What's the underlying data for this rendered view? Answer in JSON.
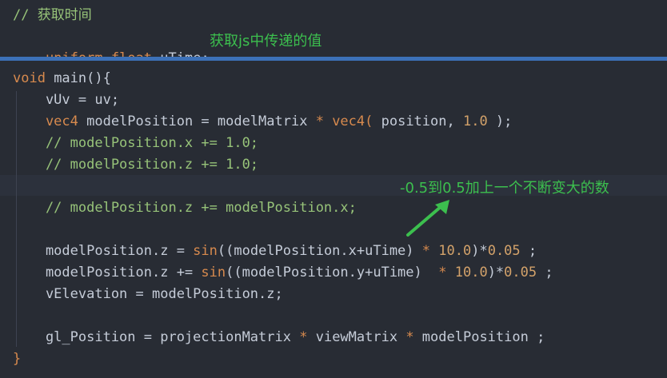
{
  "header": {
    "comment": "// 获取时间",
    "uniform_kw": "uniform",
    "float_kw": "float",
    "uniform_rest": " uTime;",
    "annotation": "获取js中传递的值"
  },
  "code": {
    "l1_kw": "void",
    "l1_rest": " main(){",
    "l2": "    vUv = uv;",
    "l3_kw": "    vec4",
    "l3_a": " modelPosition = modelMatrix ",
    "l3_op": "*",
    "l3_kw2": " vec4(",
    "l3_b": " position, ",
    "l3_num": "1.0",
    "l3_end": " );",
    "l4": "    // modelPosition.x += 1.0;",
    "l5": "    // modelPosition.z += 1.0;",
    "l7": "    // modelPosition.z += modelPosition.x;",
    "l9_a": "    modelPosition.z = ",
    "l9_sin": "sin",
    "l9_b": "((modelPosition.x+uTime) ",
    "l9_op": "*",
    "l9_sp": " ",
    "l9_num": "10.0",
    "l9_c": ")*",
    "l9_num2": "0.05",
    "l9_end": " ;",
    "l10_a": "    modelPosition.z += ",
    "l10_sin": "sin",
    "l10_b": "((modelPosition.y+uTime)  ",
    "l10_op": "*",
    "l10_sp": " ",
    "l10_num": "10.0",
    "l10_c": ")*",
    "l10_num2": "0.05",
    "l10_end": " ;",
    "l11": "    vElevation = modelPosition.z;",
    "l13_a": "    gl_Position = projectionMatrix ",
    "l13_op1": "*",
    "l13_b": " viewMatrix ",
    "l13_op2": "*",
    "l13_c": " modelPosition ;",
    "l14": "}"
  },
  "annotation2": "-0.5到0.5加上一个不断变大的数",
  "colors": {
    "annotation": "#3cbf4e",
    "divider": "#3c71b8",
    "background": "#282c34"
  }
}
